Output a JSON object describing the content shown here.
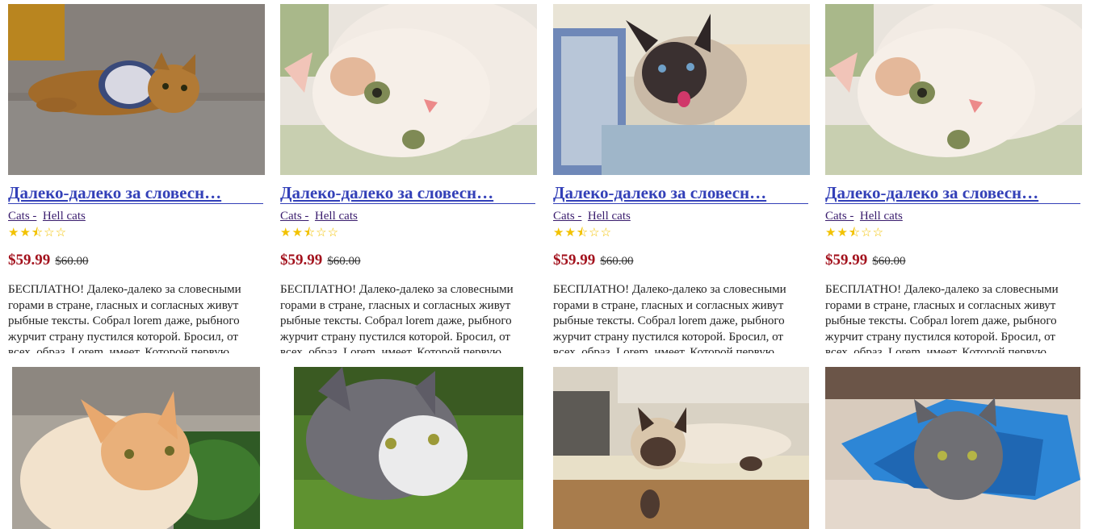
{
  "products": [
    {
      "title": "Далеко-далеко за словесн…",
      "category1": "Cats -",
      "category2": "Hell cats",
      "rating": 2.5,
      "rating_max": 5,
      "price": "$59.99",
      "old_price": "$60.00",
      "description": "БЕСПЛАТНО! Далеко-далеко за словесными горами в стране, гласных и согласных живут рыбные тексты. Собрал lorem даже, рыбного журчит страну пустился которой. Бросил, от всех, образ. Lorem, имеет. Которой первую"
    },
    {
      "title": "Далеко-далеко за словесн…",
      "category1": "Cats -",
      "category2": "Hell cats",
      "rating": 2.5,
      "rating_max": 5,
      "price": "$59.99",
      "old_price": "$60.00",
      "description": "БЕСПЛАТНО! Далеко-далеко за словесными горами в стране, гласных и согласных живут рыбные тексты. Собрал lorem даже, рыбного журчит страну пустился которой. Бросил, от всех, образ. Lorem, имеет. Которой первую"
    },
    {
      "title": "Далеко-далеко за словесн…",
      "category1": "Cats -",
      "category2": "Hell cats",
      "rating": 2.5,
      "rating_max": 5,
      "price": "$59.99",
      "old_price": "$60.00",
      "description": "БЕСПЛАТНО! Далеко-далеко за словесными горами в стране, гласных и согласных живут рыбные тексты. Собрал lorem даже, рыбного журчит страну пустился которой. Бросил, от всех, образ. Lorem, имеет. Которой первую"
    },
    {
      "title": "Далеко-далеко за словесн…",
      "category1": "Cats -",
      "category2": "Hell cats",
      "rating": 2.5,
      "rating_max": 5,
      "price": "$59.99",
      "old_price": "$60.00",
      "description": "БЕСПЛАТНО! Далеко-далеко за словесными горами в стране, гласных и согласных живут рыбные тексты. Собрал lorem даже, рыбного журчит страну пустился которой. Бросил, от всех, образ. Lorem, имеет. Которой первую"
    }
  ],
  "colors": {
    "title_link": "#3340b8",
    "category_link": "#3a1d6e",
    "price": "#a3121d",
    "star": "#f2c200"
  }
}
